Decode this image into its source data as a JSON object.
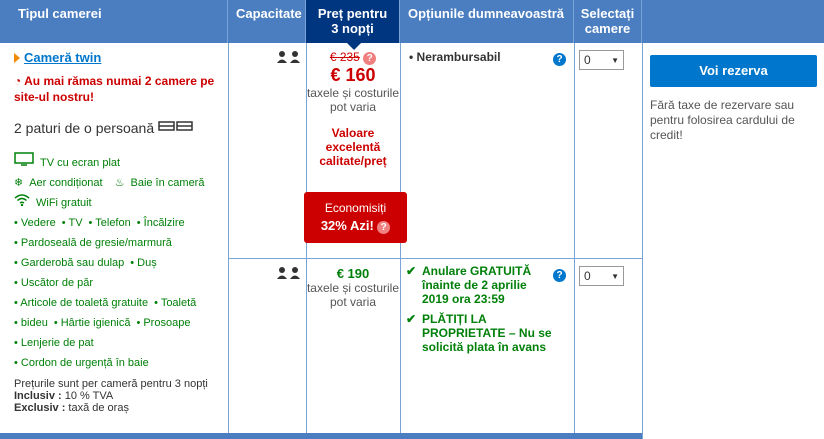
{
  "header": {
    "room_type": "Tipul camerei",
    "capacity": "Capacitate",
    "price_line1": "Preț pentru",
    "price_line2": "3 nopți",
    "options": "Opțiunile dumneavoastră",
    "select_line1": "Selectați",
    "select_line2": "camere"
  },
  "room": {
    "title": "Cameră twin",
    "scarcity": "Au mai rămas numai 2 camere pe site-ul nostru!",
    "beds": "2 paturi de o persoană",
    "facilities_main": [
      "TV cu ecran plat",
      "Aer condiționat",
      "Baie în cameră",
      "WiFi gratuit"
    ],
    "facilities": [
      [
        "• Vedere",
        "• TV",
        "• Telefon",
        "• Încălzire"
      ],
      [
        "• Pardoseală de gresie/marmură"
      ],
      [
        "• Garderobă sau dulap",
        "• Duș"
      ],
      [
        "• Uscător de păr"
      ],
      [
        "• Articole de toaletă gratuite",
        "• Toaletă"
      ],
      [
        "• bideu",
        "• Hârtie igienică",
        "• Prosoape"
      ],
      [
        "• Lenjerie de pat"
      ],
      [
        "• Cordon de urgență în baie"
      ]
    ],
    "footnote_line1": "Prețurile sunt per cameră pentru 3 nopți",
    "inclusive_label": "Inclusiv :",
    "inclusive_value": " 10 % TVA",
    "exclusive_label": "Exclusiv :",
    "exclusive_value": " taxă de oraș"
  },
  "offer1": {
    "old_price": "€ 235",
    "price": "€ 160",
    "tax_note": "taxele și costurile pot varia",
    "value_label": "Valoare excelentă calitate/preț",
    "badge_line1": "Economisiți",
    "badge_line2": "32% Azi!",
    "option": "Nerambursabil",
    "selected": "0"
  },
  "offer2": {
    "price": "€ 190",
    "tax_note": "taxele și costurile pot varia",
    "option1": "Anulare GRATUITĂ înainte de 2 aprilie 2019 ora 23:59",
    "option2": "PLĂTIȚI LA PROPRIETATE – Nu se solicită plata în avans",
    "selected": "0"
  },
  "sidebar": {
    "reserve_button": "Voi rezerva",
    "no_fee_note": "Fără taxe de rezervare sau pentru folosirea cardului de credit!"
  },
  "colors": {
    "header": "#4b7ec0",
    "header_active": "#003580",
    "accent_red": "#cc0000",
    "green": "#008009",
    "button": "#0077cc"
  }
}
